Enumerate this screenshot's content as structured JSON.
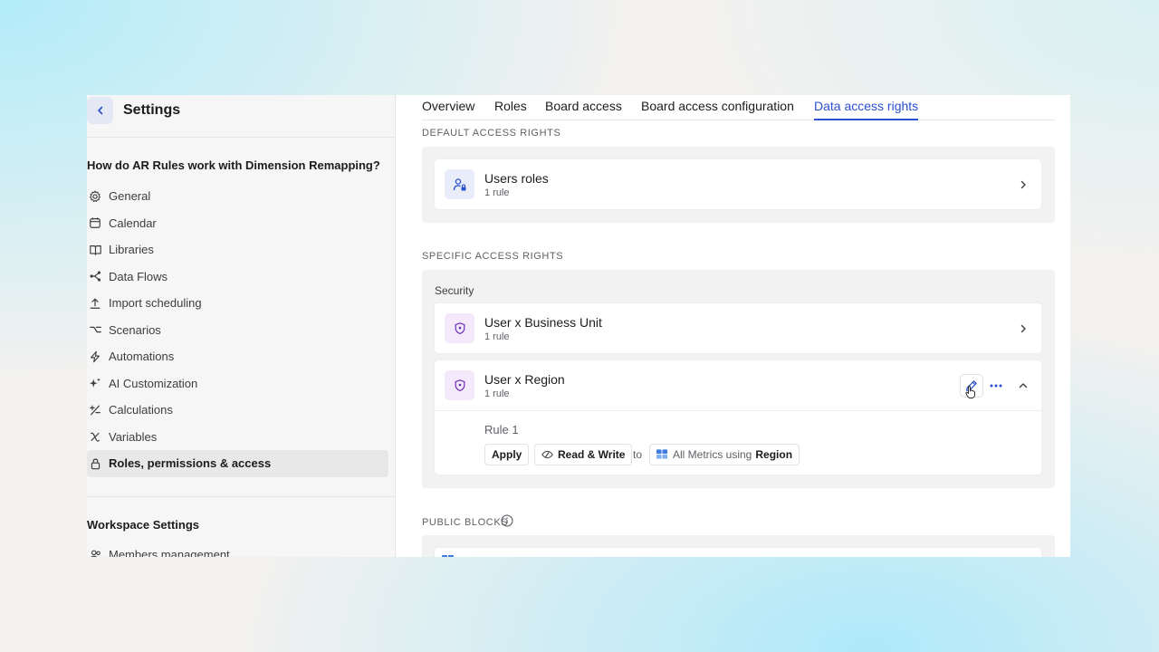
{
  "sidebar": {
    "title": "Settings",
    "section_title": "How do AR Rules work with Dimension Remapping?",
    "items": [
      {
        "label": "General",
        "icon": "gear-icon"
      },
      {
        "label": "Calendar",
        "icon": "calendar-icon"
      },
      {
        "label": "Libraries",
        "icon": "book-icon"
      },
      {
        "label": "Data Flows",
        "icon": "data-flow-icon"
      },
      {
        "label": "Import scheduling",
        "icon": "upload-icon"
      },
      {
        "label": "Scenarios",
        "icon": "branch-icon"
      },
      {
        "label": "Automations",
        "icon": "lightning-icon"
      },
      {
        "label": "AI Customization",
        "icon": "sparkle-icon"
      },
      {
        "label": "Calculations",
        "icon": "plus-minus-icon"
      },
      {
        "label": "Variables",
        "icon": "variable-x-icon"
      },
      {
        "label": "Roles, permissions & access",
        "icon": "lock-icon",
        "active": true
      }
    ],
    "workspace_title": "Workspace Settings",
    "workspace_items": [
      {
        "label": "Members management",
        "icon": "users-icon"
      }
    ]
  },
  "tabs": [
    {
      "label": "Overview"
    },
    {
      "label": "Roles"
    },
    {
      "label": "Board access"
    },
    {
      "label": "Board access configuration"
    },
    {
      "label": "Data access rights",
      "active": true
    }
  ],
  "default_access": {
    "label": "DEFAULT ACCESS RIGHTS",
    "card": {
      "title": "Users roles",
      "subtitle": "1 rule"
    }
  },
  "specific_access": {
    "label": "SPECIFIC ACCESS RIGHTS",
    "group_label": "Security",
    "cards": [
      {
        "title": "User x Business Unit",
        "subtitle": "1 rule"
      },
      {
        "title": "User x Region",
        "subtitle": "1 rule"
      }
    ],
    "rule": {
      "title": "Rule 1",
      "apply_label": "Apply",
      "permission_label": "Read & Write",
      "to_label": "to",
      "target_prefix": "All Metrics using",
      "target_dimension": "Region"
    }
  },
  "public_blocks": {
    "label": "PUBLIC BLOCKS"
  },
  "colors": {
    "accent": "#2b50d0",
    "shield_purple": "#6b2fb3"
  }
}
